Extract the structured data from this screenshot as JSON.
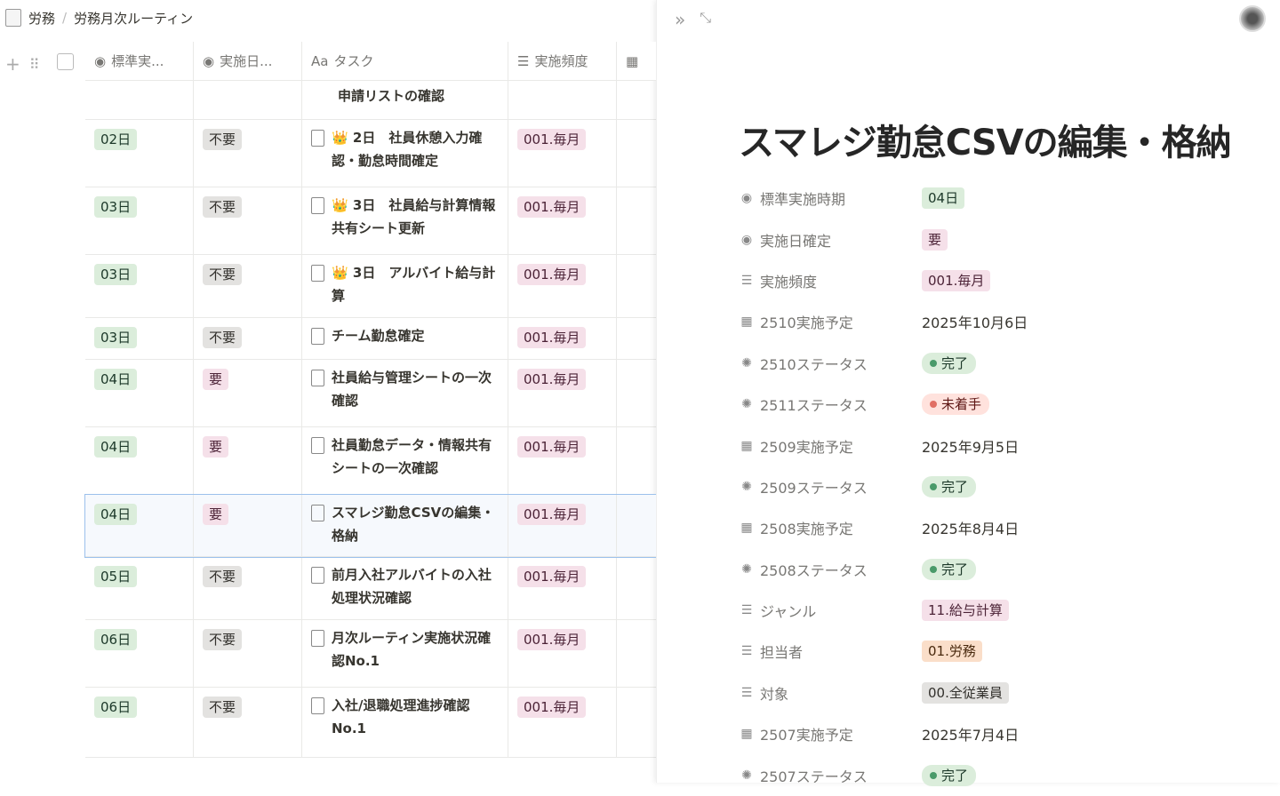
{
  "breadcrumb": [
    "労務",
    "労務月次ルーティン"
  ],
  "table": {
    "columns": [
      "標準実...",
      "実施日...",
      "タスク",
      "実施頻度"
    ],
    "partial_row": {
      "task": "申請リストの確認"
    },
    "rows": [
      {
        "std": "02日",
        "confirm": "不要",
        "emoji": "👑",
        "task": "2日　社員休憩入力確認・勤怠時間確定",
        "freq": "001.毎月",
        "h": 76
      },
      {
        "std": "03日",
        "confirm": "不要",
        "emoji": "👑",
        "task": "3日　社員給与計算情報共有シート更新",
        "freq": "001.毎月",
        "h": 76
      },
      {
        "std": "03日",
        "confirm": "不要",
        "emoji": "👑",
        "task": "3日　アルバイト給与計算",
        "freq": "001.毎月",
        "h": 71
      },
      {
        "std": "03日",
        "confirm": "不要",
        "emoji": "",
        "task": "チーム勤怠確定",
        "freq": "001.毎月",
        "h": 47
      },
      {
        "std": "04日",
        "confirm": "要",
        "emoji": "",
        "task": "社員給与管理シートの一次確認",
        "freq": "001.毎月",
        "h": 76
      },
      {
        "std": "04日",
        "confirm": "要",
        "emoji": "",
        "task": "社員勤怠データ・情報共有シートの一次確認",
        "freq": "001.毎月",
        "h": 76
      },
      {
        "std": "04日",
        "confirm": "要",
        "emoji": "",
        "task": "スマレジ勤怠CSVの編集・格納",
        "freq": "001.毎月",
        "h": 70,
        "selected": true
      },
      {
        "std": "05日",
        "confirm": "不要",
        "emoji": "",
        "task": "前月入社アルバイトの入社処理状況確認",
        "freq": "001.毎月",
        "h": 71
      },
      {
        "std": "06日",
        "confirm": "不要",
        "emoji": "",
        "task": "月次ルーティン実施状況確認No.1",
        "freq": "001.毎月",
        "h": 76
      },
      {
        "std": "06日",
        "confirm": "不要",
        "emoji": "",
        "task": "入社/退職処理進捗確認No.1",
        "freq": "001.毎月",
        "h": 79
      }
    ]
  },
  "detail": {
    "title": "スマレジ勤怠CSVの編集・格納",
    "props": [
      {
        "icon": "◉",
        "label": "標準実施時期",
        "value": "04日",
        "tag": "g"
      },
      {
        "icon": "◉",
        "label": "実施日確定",
        "value": "要",
        "tag": "p"
      },
      {
        "icon": "☰",
        "label": "実施頻度",
        "value": "001.毎月",
        "tag": "p"
      },
      {
        "icon": "▦",
        "label": "2510実施予定",
        "value": "2025年10月6日",
        "tag": ""
      },
      {
        "icon": "✺",
        "label": "2510ステータス",
        "value": "完了",
        "tag": "g",
        "dot": "#4a9a6a"
      },
      {
        "icon": "✺",
        "label": "2511ステータス",
        "value": "未着手",
        "tag": "r",
        "dot": "#e16f64"
      },
      {
        "icon": "▦",
        "label": "2509実施予定",
        "value": "2025年9月5日",
        "tag": ""
      },
      {
        "icon": "✺",
        "label": "2509ステータス",
        "value": "完了",
        "tag": "g",
        "dot": "#4a9a6a"
      },
      {
        "icon": "▦",
        "label": "2508実施予定",
        "value": "2025年8月4日",
        "tag": ""
      },
      {
        "icon": "✺",
        "label": "2508ステータス",
        "value": "完了",
        "tag": "g",
        "dot": "#4a9a6a"
      },
      {
        "icon": "☰",
        "label": "ジャンル",
        "value": "11.給与計算",
        "tag": "p"
      },
      {
        "icon": "☰",
        "label": "担当者",
        "value": "01.労務",
        "tag": "o"
      },
      {
        "icon": "☰",
        "label": "対象",
        "value": "00.全従業員",
        "tag": "gr"
      },
      {
        "icon": "▦",
        "label": "2507実施予定",
        "value": "2025年7月4日",
        "tag": ""
      },
      {
        "icon": "✺",
        "label": "2507ステータス",
        "value": "完了",
        "tag": "g",
        "dot": "#4a9a6a"
      }
    ]
  }
}
